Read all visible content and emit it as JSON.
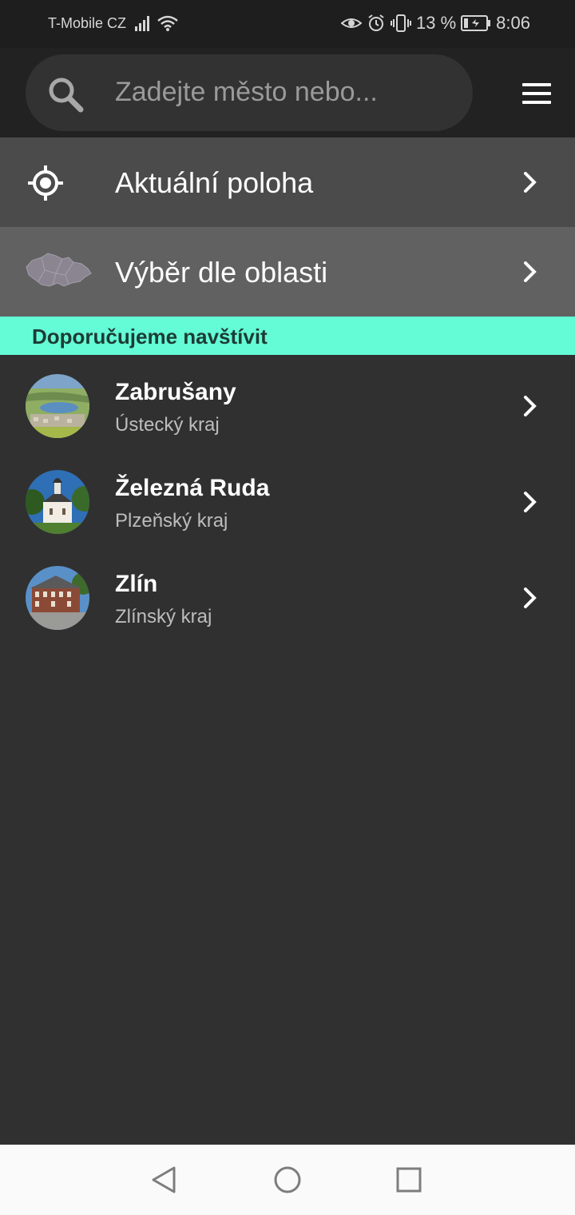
{
  "status_bar": {
    "carrier": "T-Mobile CZ",
    "battery_percent": "13 %",
    "time": "8:06",
    "icons": [
      "signal-icon",
      "wifi-icon",
      "eye-icon",
      "alarm-icon",
      "vibrate-icon",
      "battery-charging-icon"
    ]
  },
  "search": {
    "placeholder": "Zadejte město nebo...",
    "value": ""
  },
  "menu": {
    "current_location": "Aktuální poloha",
    "area_selection": "Výběr dle oblasti"
  },
  "recommended": {
    "header": "Doporučujeme navštívit",
    "items": [
      {
        "name": "Zabrušany",
        "region": "Ústecký kraj"
      },
      {
        "name": "Železná Ruda",
        "region": "Plzeňský kraj"
      },
      {
        "name": "Zlín",
        "region": "Zlínský kraj"
      }
    ]
  },
  "colors": {
    "accent": "#64fcd6",
    "background": "#303030",
    "appbar": "#222222",
    "statusbar": "#1e1e1e"
  }
}
